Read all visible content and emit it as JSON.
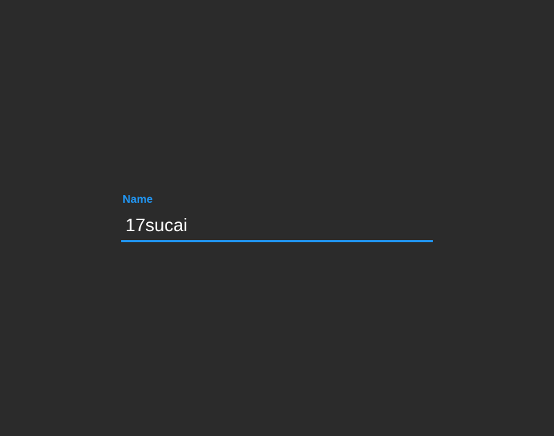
{
  "form": {
    "name_label": "Name",
    "name_value": "17sucai"
  },
  "colors": {
    "background": "#2b2b2b",
    "accent": "#2196f3",
    "text": "#ffffff"
  }
}
